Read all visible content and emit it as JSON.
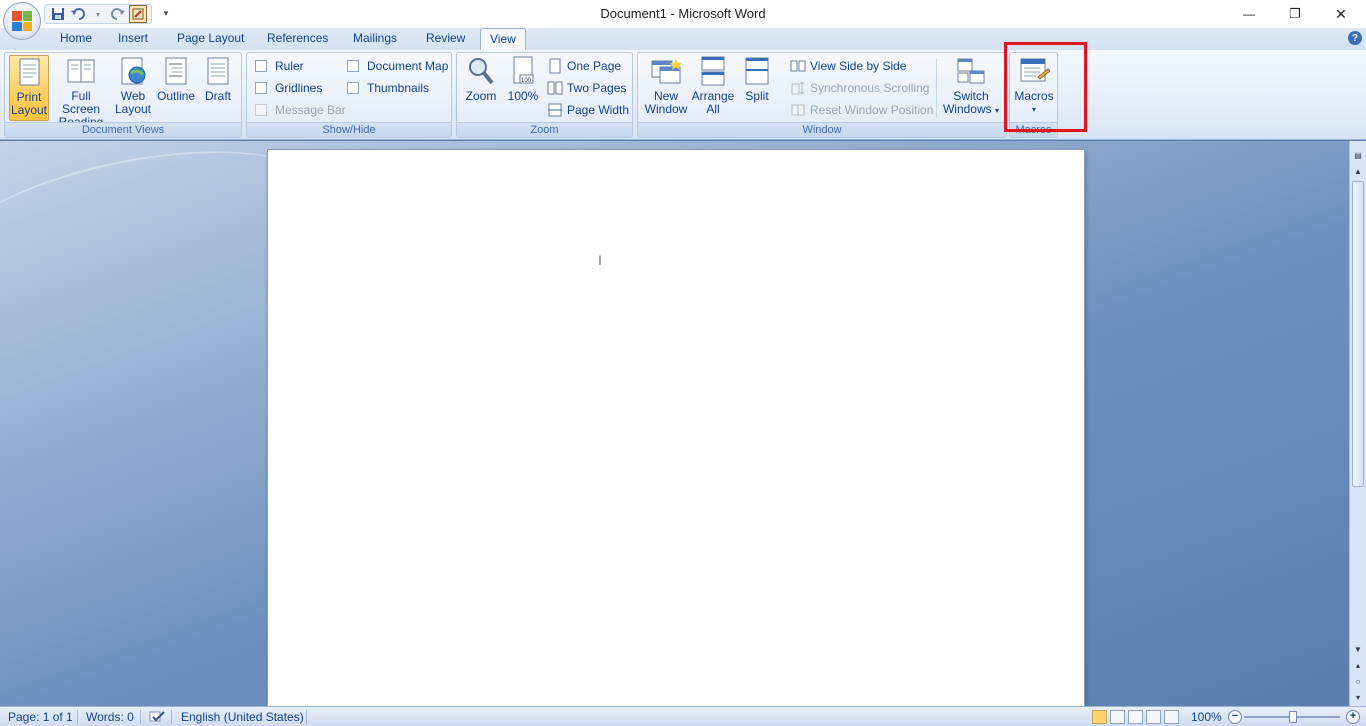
{
  "window": {
    "title": "Document1 - Microsoft Word",
    "minimize_glyph": "—",
    "restore_glyph": "❐",
    "close_glyph": "✕"
  },
  "qat": {
    "icons": [
      "save-icon",
      "undo-icon",
      "redo-icon",
      "customize-icon"
    ],
    "dropdown_glyph": "▾"
  },
  "tabs": [
    {
      "label": "Home"
    },
    {
      "label": "Insert"
    },
    {
      "label": "Page Layout"
    },
    {
      "label": "References"
    },
    {
      "label": "Mailings"
    },
    {
      "label": "Review"
    },
    {
      "label": "View",
      "active": true
    }
  ],
  "help_glyph": "?",
  "ribbon": {
    "document_views": {
      "label": "Document Views",
      "buttons": [
        {
          "line1": "Print",
          "line2": "Layout",
          "selected": true
        },
        {
          "line1": "Full Screen",
          "line2": "Reading"
        },
        {
          "line1": "Web",
          "line2": "Layout"
        },
        {
          "line1": "Outline",
          "line2": ""
        },
        {
          "line1": "Draft",
          "line2": ""
        }
      ]
    },
    "show_hide": {
      "label": "Show/Hide",
      "ruler": "Ruler",
      "gridlines": "Gridlines",
      "message_bar": "Message Bar",
      "document_map": "Document Map",
      "thumbnails": "Thumbnails"
    },
    "zoom": {
      "label": "Zoom",
      "zoom_btn": "Zoom",
      "hundred_btn": "100%",
      "one_page": "One Page",
      "two_pages": "Two Pages",
      "page_width": "Page Width"
    },
    "window": {
      "label": "Window",
      "new_window_1": "New",
      "new_window_2": "Window",
      "arrange_1": "Arrange",
      "arrange_2": "All",
      "split": "Split",
      "view_side": "View Side by Side",
      "sync_scroll": "Synchronous Scrolling",
      "reset_pos": "Reset Window Position",
      "switch_1": "Switch",
      "switch_2": "Windows"
    },
    "macros": {
      "label": "Macros",
      "button": "Macros"
    }
  },
  "statusbar": {
    "page": "Page: 1 of 1",
    "words": "Words: 0",
    "language": "English (United States)",
    "zoom": "100%",
    "zoom_minus": "−",
    "zoom_plus": "+"
  },
  "colors": {
    "highlight": "#e0141e",
    "accent": "#15428b"
  }
}
